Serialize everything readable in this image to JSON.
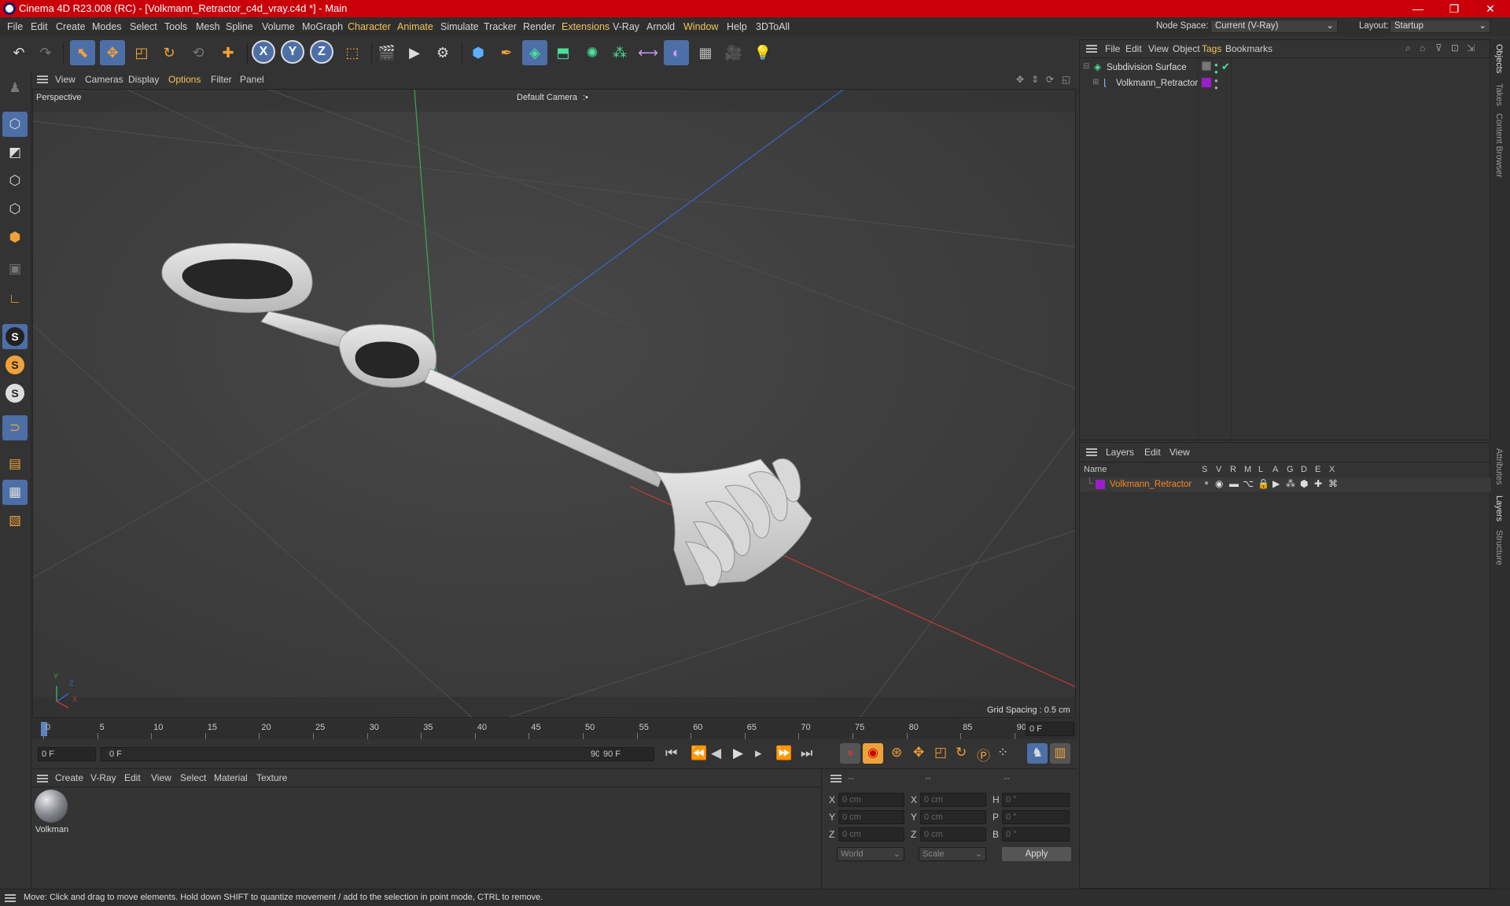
{
  "window": {
    "title": "Cinema 4D R23.008 (RC) - [Volkmann_Retractor_c4d_vray.c4d *] - Main",
    "controls": {
      "minimize": "—",
      "restore": "❐",
      "close": "✕"
    }
  },
  "menubar": {
    "items": [
      "File",
      "Edit",
      "Create",
      "Modes",
      "Select",
      "Tools",
      "Mesh",
      "Spline",
      "Volume",
      "MoGraph",
      "Character",
      "Animate",
      "Simulate",
      "Tracker",
      "Render",
      "Extensions",
      "V-Ray",
      "Arnold",
      "Window",
      "Help",
      "3DToAll"
    ],
    "node_space_label": "Node Space:",
    "node_space_value": "Current (V-Ray)",
    "layout_label": "Layout:",
    "layout_value": "Startup"
  },
  "toolbar": {
    "axis_x": "X",
    "axis_y": "Y",
    "axis_z": "Z"
  },
  "left_toolbar": {
    "s1": "S",
    "s2": "S",
    "s3": "S"
  },
  "viewport": {
    "menu": [
      "View",
      "Cameras",
      "Display",
      "Options",
      "Filter",
      "Panel"
    ],
    "view_name": "Perspective",
    "camera": "Default Camera",
    "camera_suffix": ":•",
    "grid_spacing": "Grid Spacing : 0.5 cm",
    "axis_y": "Y",
    "axis_z": "Z",
    "axis_x": "X"
  },
  "timeline": {
    "ticks": [
      "0",
      "5",
      "10",
      "15",
      "20",
      "25",
      "30",
      "35",
      "40",
      "45",
      "50",
      "55",
      "60",
      "65",
      "70",
      "75",
      "80",
      "85",
      "90"
    ],
    "current_frame": "0 F",
    "start_frame": "0 F",
    "range_start": "0 F",
    "range_end": "90 F",
    "end_frame": "90 F",
    "end_frame_box": "90 F"
  },
  "material_manager": {
    "menu": [
      "Create",
      "V-Ray",
      "Edit",
      "View",
      "Select",
      "Material",
      "Texture"
    ],
    "materials": [
      {
        "name": "Volkman"
      }
    ]
  },
  "attributes": {
    "header": [
      "--",
      "--",
      "--"
    ],
    "rows": [
      {
        "a": "X",
        "av": "0 cm",
        "b": "X",
        "bv": "0 cm",
        "c": "H",
        "cv": "0 °"
      },
      {
        "a": "Y",
        "av": "0 cm",
        "b": "Y",
        "bv": "0 cm",
        "c": "P",
        "cv": "0 °"
      },
      {
        "a": "Z",
        "av": "0 cm",
        "b": "Z",
        "bv": "0 cm",
        "c": "B",
        "cv": "0 °"
      }
    ],
    "coord_mode": "World",
    "size_mode": "Scale",
    "apply": "Apply"
  },
  "object_manager": {
    "menu": [
      "File",
      "Edit",
      "View",
      "Object",
      "Tags",
      "Bookmarks"
    ],
    "objects": [
      {
        "name": "Subdivision Surface",
        "indent": false
      },
      {
        "name": "Volkmann_Retractor",
        "indent": true
      }
    ]
  },
  "layer_manager": {
    "menu": [
      "Layers",
      "Edit",
      "View"
    ],
    "columns": [
      "Name",
      "S",
      "V",
      "R",
      "M",
      "L",
      "A",
      "G",
      "D",
      "E",
      "X"
    ],
    "layers": [
      {
        "name": "Volkmann_Retractor",
        "color": "#9b1fc8"
      }
    ]
  },
  "right_tabs": [
    "Objects",
    "Takes",
    "Content Browser",
    "Attributes",
    "Layers",
    "Structure"
  ],
  "status": {
    "message": "Move: Click and drag to move elements. Hold down SHIFT to quantize movement / add to the selection in point mode, CTRL to remove."
  },
  "colors": {
    "title_bar": "#c9000a",
    "accent_active": "#4d6fa8",
    "highlight_text": "#f3c45d",
    "layer_name": "#f08a24",
    "layer_swatch": "#9b1fc8"
  }
}
